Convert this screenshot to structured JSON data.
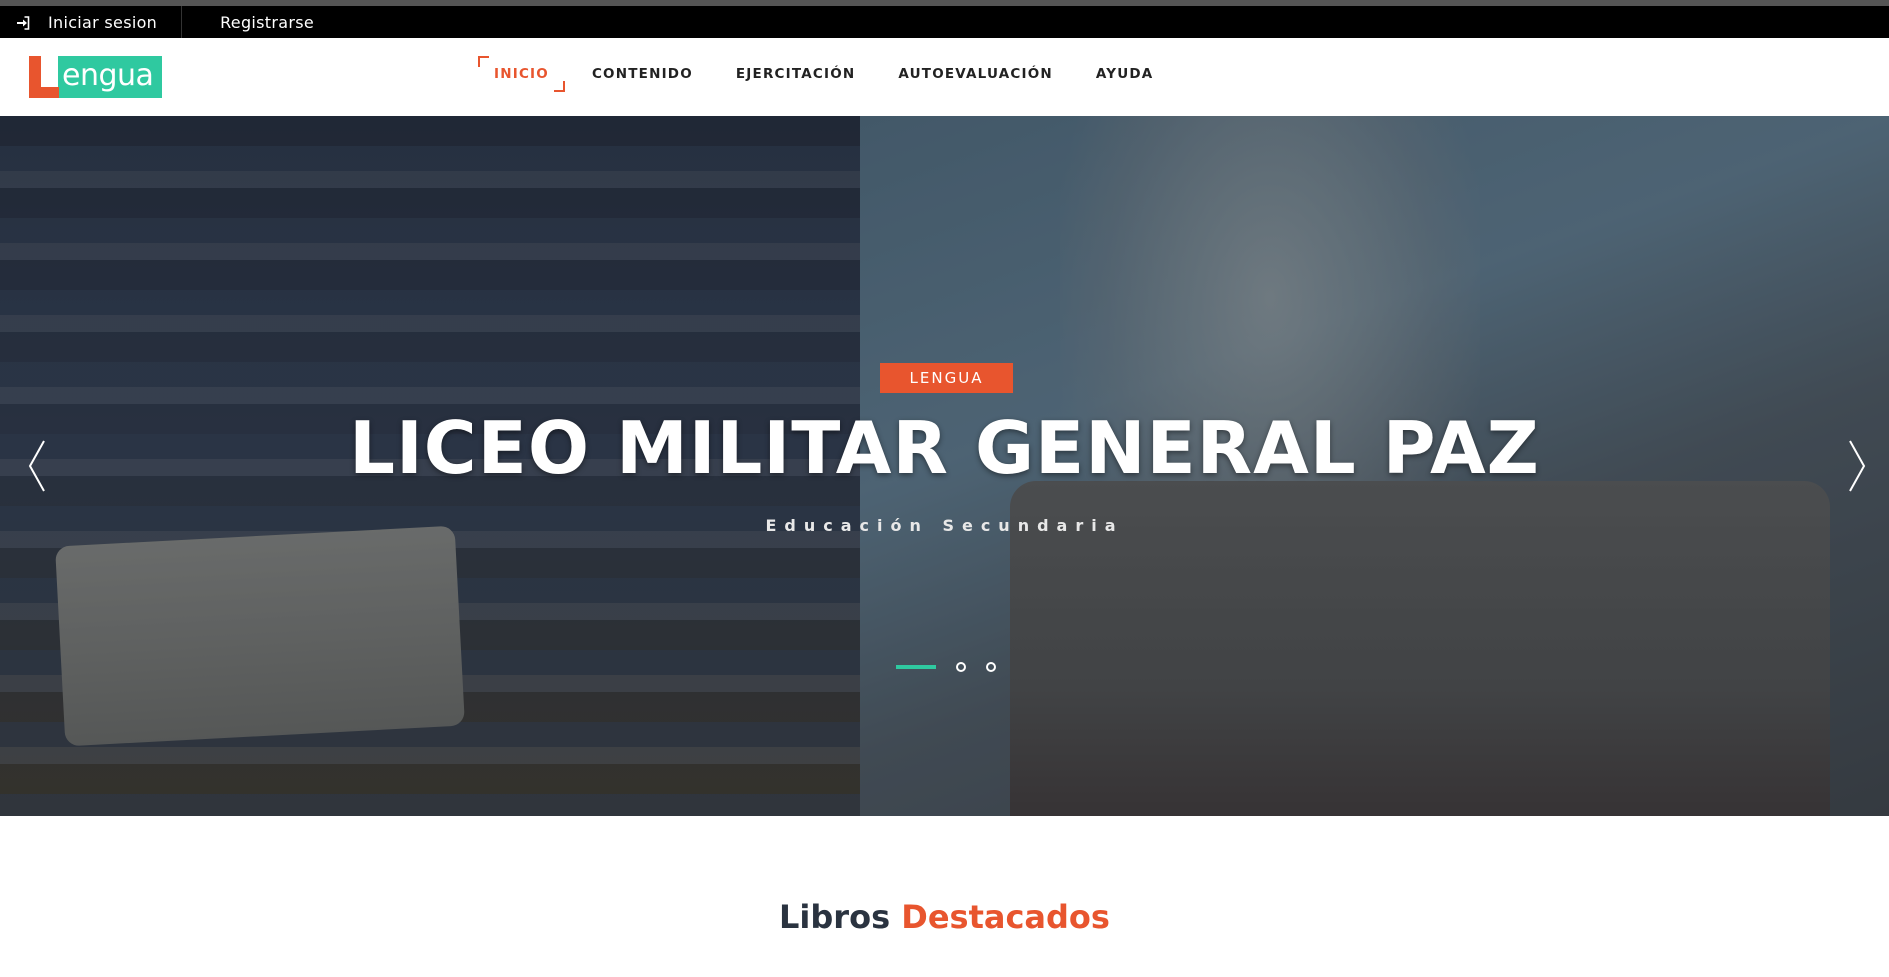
{
  "topbar": {
    "login_label": "Iniciar sesion",
    "register_label": "Registrarse",
    "login_icon": "sign-in-icon"
  },
  "header": {
    "logo_letter": "L",
    "logo_word": "engua",
    "nav": [
      {
        "label": "INICIO",
        "active": true
      },
      {
        "label": "CONTENIDO",
        "active": false
      },
      {
        "label": "EJERCITACIÓN",
        "active": false
      },
      {
        "label": "AUTOEVALUACIÓN",
        "active": false
      },
      {
        "label": "AYUDA",
        "active": false
      }
    ]
  },
  "hero": {
    "badge": "LENGUA",
    "title": "LICEO MILITAR GENERAL PAZ",
    "subtitle": "Educación Secundaria",
    "prev_icon": "chevron-left-icon",
    "next_icon": "chevron-right-icon",
    "slides_total": 3,
    "active_slide": 1
  },
  "section": {
    "title_part1": "Libros",
    "title_part2": "Destacados"
  },
  "colors": {
    "accent_orange": "#e8552e",
    "accent_green": "#2fc9a0",
    "topbar_bg": "#000000",
    "text_dark": "#2a3340"
  }
}
